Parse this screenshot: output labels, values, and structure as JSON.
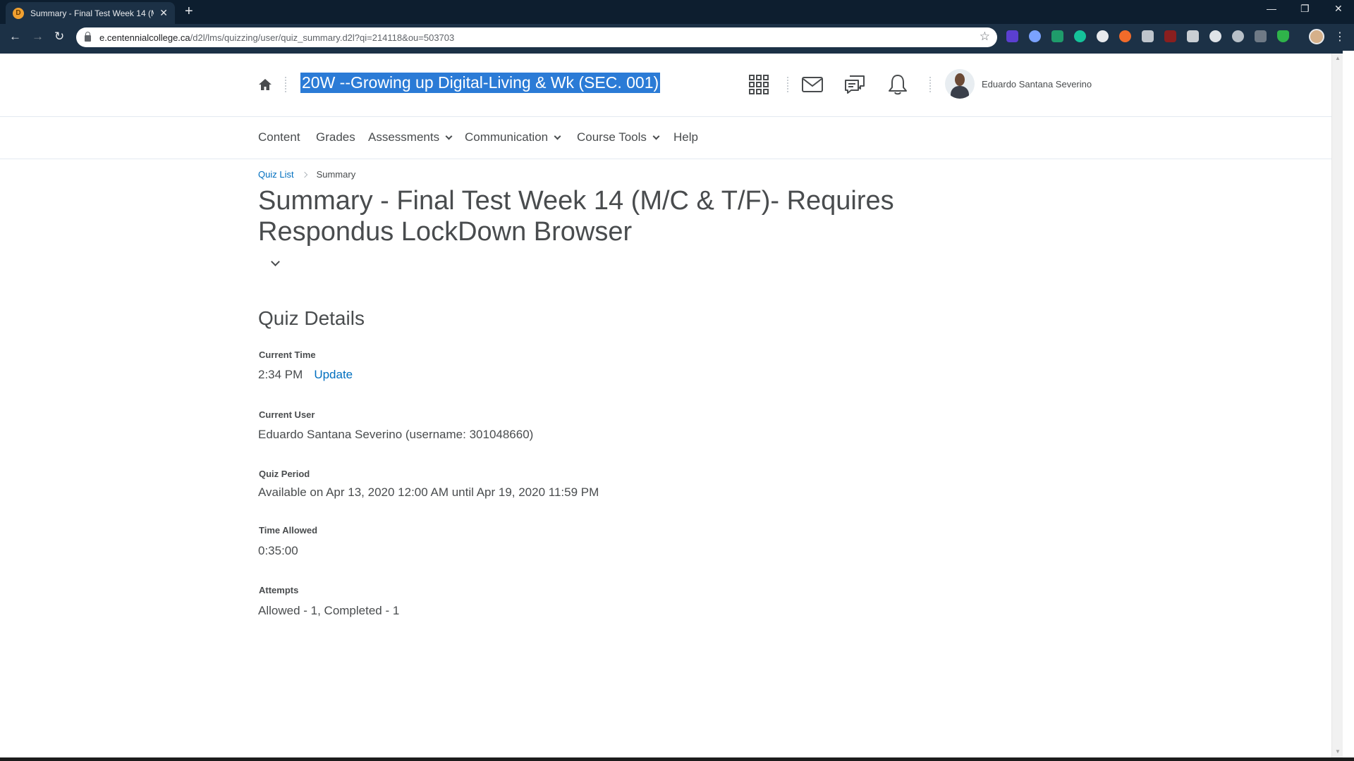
{
  "browser": {
    "tab_title": "Summary - Final Test Week 14 (M/C",
    "tab_favicon": "D",
    "url_host": "e.centennialcollege.ca",
    "url_path": "/d2l/lms/quizzing/user/quiz_summary.d2l?qi=214118&ou=503703"
  },
  "header": {
    "course_title": "20W --Growing up Digital-Living & Wk (SEC. 001)",
    "user_name": "Eduardo Santana Severino"
  },
  "nav": {
    "items": [
      {
        "label": "Content"
      },
      {
        "label": "Grades"
      },
      {
        "label": "Assessments"
      },
      {
        "label": "Communication"
      },
      {
        "label": "Course Tools"
      },
      {
        "label": "Help"
      }
    ]
  },
  "breadcrumb": {
    "link": "Quiz List",
    "current": "Summary"
  },
  "page": {
    "title": "Summary - Final Test Week 14 (M/C & T/F)- Requires Respondus LockDown Browser",
    "section_heading": "Quiz Details"
  },
  "details": {
    "current_time_label": "Current Time",
    "current_time_value": "2:34 PM",
    "update_label": "Update",
    "current_user_label": "Current User",
    "current_user_value": "Eduardo Santana Severino (username: 301048660)",
    "quiz_period_label": "Quiz Period",
    "quiz_period_value": "Available on Apr 13, 2020 12:00 AM until Apr 19, 2020 11:59 PM",
    "time_allowed_label": "Time Allowed",
    "time_allowed_value": "0:35:00",
    "attempts_label": "Attempts",
    "attempts_value": "Allowed - 1, Completed - 1"
  },
  "colors": {
    "link": "#006fbf",
    "selection": "#2b7bd6",
    "chrome_dark": "#0d1e2f",
    "text": "#494c4e"
  }
}
